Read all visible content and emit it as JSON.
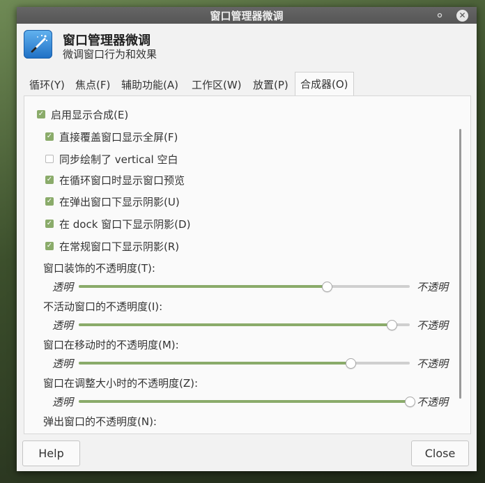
{
  "window": {
    "title": "窗口管理器微调"
  },
  "titlebar": {
    "minimize_icon": "minimize-icon",
    "close_icon": "close-icon"
  },
  "header": {
    "icon": "tweaks-wand-icon",
    "title": "窗口管理器微调",
    "subtitle": "微调窗口行为和效果"
  },
  "tabs": [
    {
      "label": "循环(Y)"
    },
    {
      "label": "焦点(F)"
    },
    {
      "label": "辅助功能(A)"
    },
    {
      "label": "工作区(W)"
    },
    {
      "label": "放置(P)"
    },
    {
      "label": "合成器(O)",
      "active": true
    }
  ],
  "compositor": {
    "enable": {
      "label": "启用显示合成(E)",
      "checked": true
    },
    "options": [
      {
        "label": "直接覆盖窗口显示全屏(F)",
        "checked": true
      },
      {
        "label": "同步绘制了 vertical 空白",
        "checked": false
      },
      {
        "label": "在循环窗口时显示窗口预览",
        "checked": true
      },
      {
        "label": "在弹出窗口下显示阴影(U)",
        "checked": true
      },
      {
        "label": "在 dock 窗口下显示阴影(D)",
        "checked": true
      },
      {
        "label": "在常规窗口下显示阴影(R)",
        "checked": true
      }
    ],
    "sliders": [
      {
        "label": "窗口装饰的不透明度(T):",
        "left": "透明",
        "right": "不透明",
        "value": 0.75
      },
      {
        "label": "不活动窗口的不透明度(I):",
        "left": "透明",
        "right": "不透明",
        "value": 0.945
      },
      {
        "label": "窗口在移动时的不透明度(M):",
        "left": "透明",
        "right": "不透明",
        "value": 0.82
      },
      {
        "label": "窗口在调整大小时的不透明度(Z):",
        "left": "透明",
        "right": "不透明",
        "value": 1.0
      }
    ],
    "partial_label": "弹出窗口的不透明度(N):"
  },
  "buttons": {
    "help": "Help",
    "close": "Close"
  },
  "colors": {
    "accent": "#8aab6a",
    "titlebar": "#5a5a5a",
    "window_bg": "#f2f2f2"
  }
}
